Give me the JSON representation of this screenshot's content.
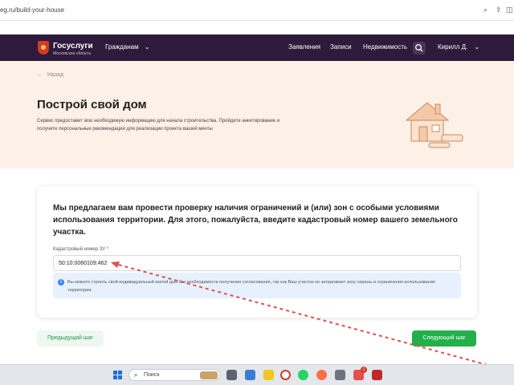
{
  "browser": {
    "url": "eg.ru/build-your-house"
  },
  "header": {
    "logo_title": "Госуслуги",
    "logo_subtitle": "Московская область",
    "audience": "Гражданам",
    "nav": [
      "Заявления",
      "Записи",
      "Недвижимость"
    ],
    "user": "Кирилл Д."
  },
  "hero": {
    "back": "Назад",
    "title": "Построй свой дом",
    "description": "Сервис предоставит всю необходимую информацию для начала строительства. Пройдите анкетирование и получите персональные рекомендации для реализации проекта вашей мечты"
  },
  "card": {
    "text": "Мы предлагаем вам провести проверку наличия ограничений и (или) зон с особыми условиями использования территории. Для этого, пожалуйста, введите кадастровый номер вашего земельного участка.",
    "field_label": "Кадастровый номер ЗУ",
    "field_required": "*",
    "field_value": "50:10:0060109:462",
    "info_icon": "i",
    "info_text": "Вы можете строить свой индивидуальный жилой дом без необходимости получения согласования, так как Ваш участок не затрагивает зону охраны и ограничения использования территории."
  },
  "buttons": {
    "prev": "Предыдущий шаг",
    "next": "Следующий шаг"
  },
  "taskbar": {
    "search_label": "Поиск",
    "notification_count": "1"
  },
  "colors": {
    "header": "#2e1a3a",
    "hero": "#fdf0e6",
    "primary_green": "#22b04b",
    "info_bg": "#e7f1fd",
    "annotation_arrow": "#e05050"
  }
}
